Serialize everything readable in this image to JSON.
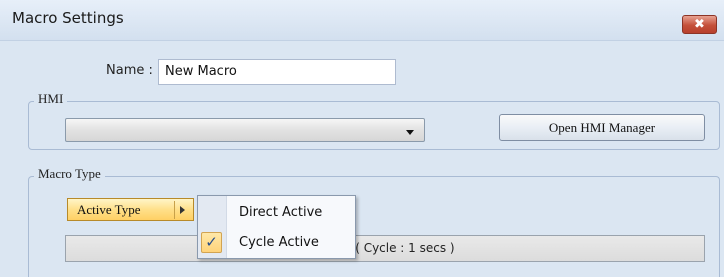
{
  "window": {
    "title": "Macro Settings",
    "close_label": "✖"
  },
  "name_field": {
    "label": "Name :",
    "value": "New Macro"
  },
  "hmi_group": {
    "legend": "HMI",
    "selected": "",
    "open_button": "Open HMI Manager"
  },
  "macro_type_group": {
    "legend": "Macro Type",
    "active_type_button": "Active Type",
    "status_text": "e ( Cycle : 1 secs )"
  },
  "active_type_menu": {
    "items": [
      {
        "label": "Direct Active",
        "checked": false
      },
      {
        "label": "Cycle Active",
        "checked": true
      }
    ],
    "check_glyph": "✓"
  },
  "colors": {
    "window_bg": "#dbe6f2",
    "close_button": "#c4503a",
    "active_type_highlight": "#ffe08a"
  }
}
